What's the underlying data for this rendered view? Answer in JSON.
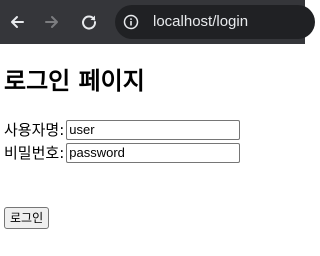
{
  "browser": {
    "url": "localhost/login"
  },
  "page": {
    "title": "로그인 페이지",
    "username_label": "사용자명:",
    "username_value": "user",
    "password_label": "비밀번호:",
    "password_value": "password",
    "login_button": "로그인"
  },
  "colors": {
    "toolbar": "#35363a",
    "omnibox": "#202124",
    "url_text": "#e8eaed",
    "nav_icon_enabled": "#e8eaed",
    "nav_icon_disabled": "#7c7d80"
  }
}
